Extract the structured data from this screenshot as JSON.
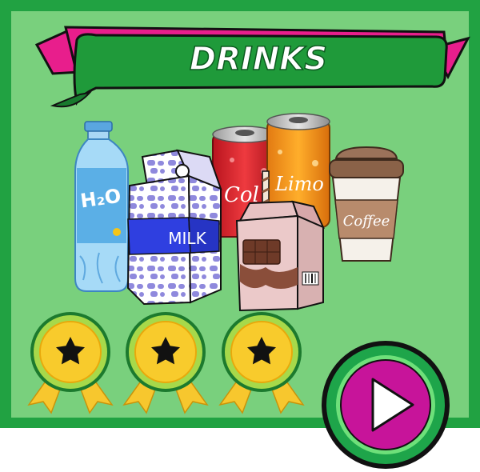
{
  "title": "DRINKS",
  "labels": {
    "water": "H₂O",
    "milk": "MILK",
    "cola": "Col",
    "lemon": "Limo",
    "coffee": "Coffee"
  },
  "stars": {
    "earned": 3,
    "total": 3
  },
  "colors": {
    "frame_green": "#21a242",
    "panel_green": "#79d07d",
    "banner_green": "#1f9a3a",
    "ribbon_pink": "#e81e8c",
    "play_magenta": "#c7149a",
    "medal_yellow": "#f5c518"
  },
  "icons": [
    "star-medal-icon",
    "play-icon"
  ]
}
